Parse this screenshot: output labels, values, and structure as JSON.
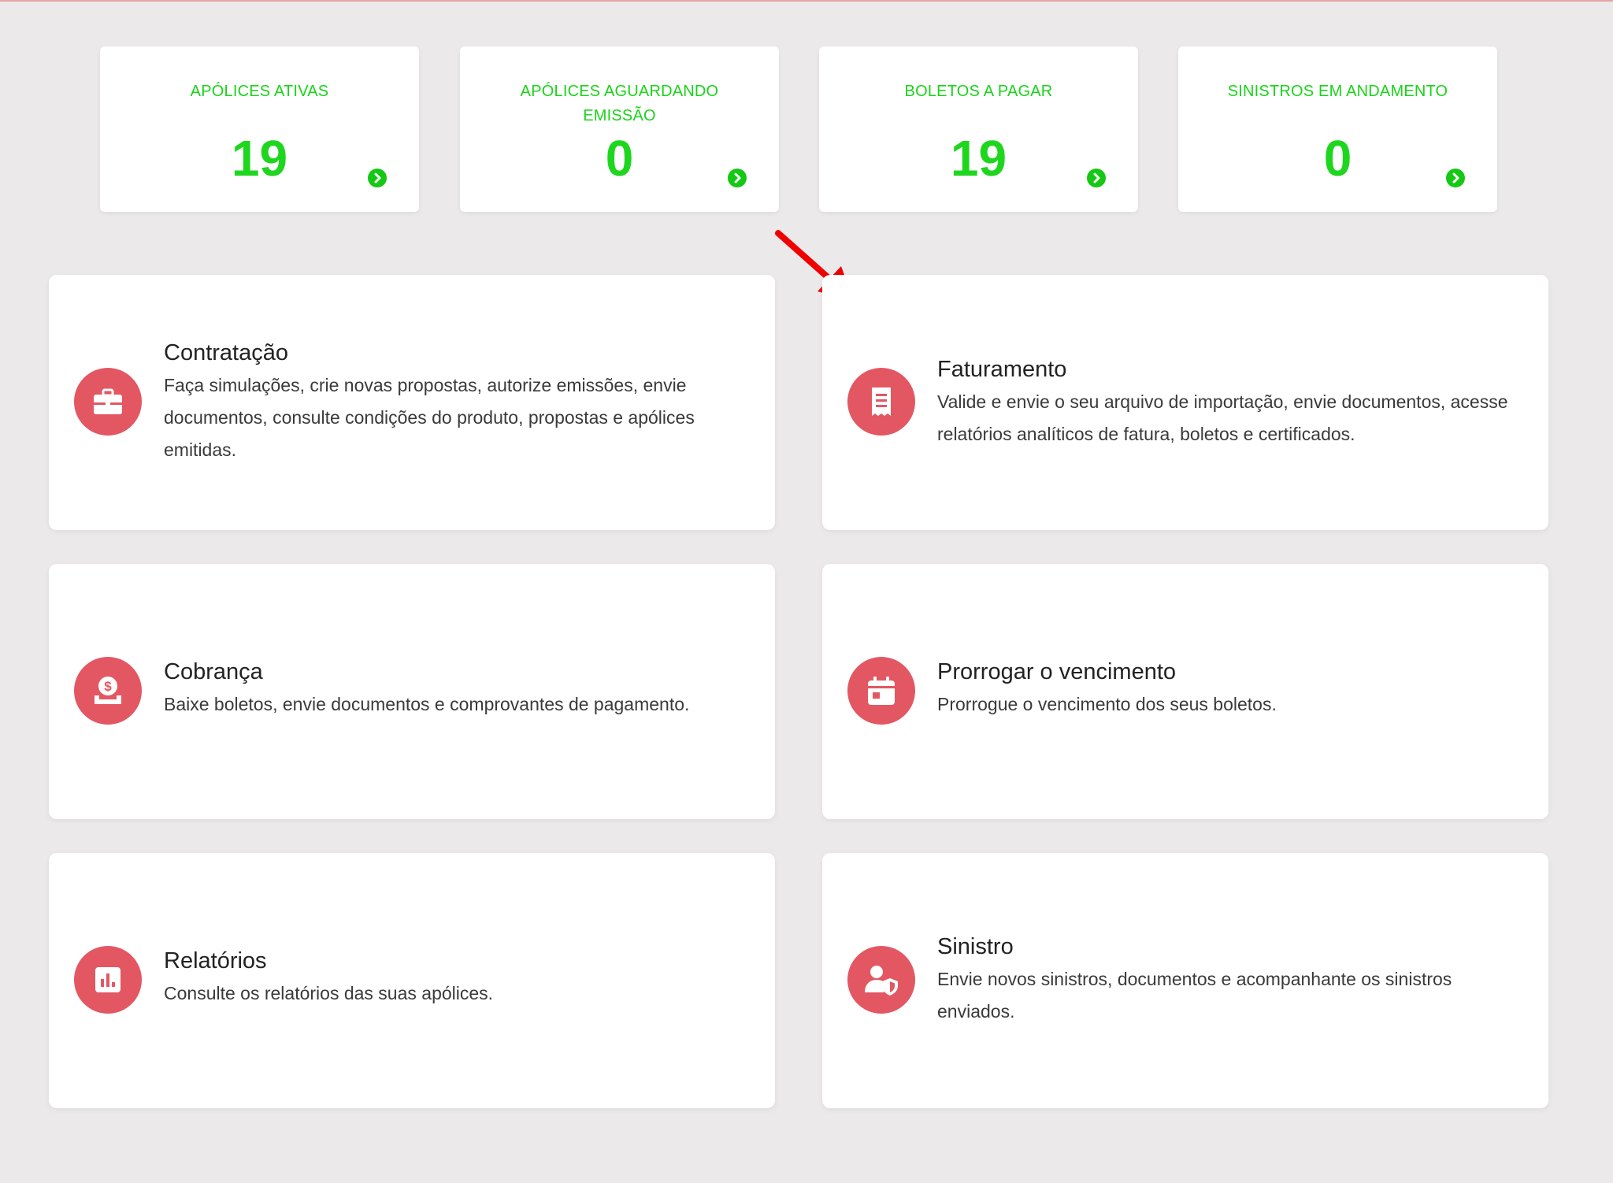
{
  "stats": [
    {
      "label": "APÓLICES ATIVAS",
      "value": "19"
    },
    {
      "label": "APÓLICES AGUARDANDO EMISSÃO",
      "value": "0"
    },
    {
      "label": "BOLETOS A PAGAR",
      "value": "19"
    },
    {
      "label": "SINISTROS EM ANDAMENTO",
      "value": "0"
    }
  ],
  "cards": [
    {
      "title": "Contratação",
      "description": "Faça simulações, crie novas propostas, autorize emissões, envie documentos, consulte condições do produto, propostas e apólices emitidas.",
      "icon": "briefcase-icon"
    },
    {
      "title": "Faturamento",
      "description": "Valide e envie o seu arquivo de importação, envie documentos, acesse relatórios analíticos de fatura, boletos e certificados.",
      "icon": "receipt-icon"
    },
    {
      "title": "Cobrança",
      "description": "Baixe boletos, envie documentos e comprovantes de pagamento.",
      "icon": "money-tray-icon"
    },
    {
      "title": "Prorrogar o vencimento",
      "description": "Prorrogue o vencimento dos seus boletos.",
      "icon": "calendar-icon"
    },
    {
      "title": "Relatórios",
      "description": "Consulte os relatórios das suas apólices.",
      "icon": "bar-chart-icon"
    },
    {
      "title": "Sinistro",
      "description": "Envie novos sinistros, documentos e acompanhante os sinistros enviados.",
      "icon": "user-shield-icon"
    }
  ],
  "colors": {
    "accent_green": "#1fd61f",
    "icon_red": "#e35762",
    "annotation_red": "#f00000",
    "background": "#ebe9ea"
  }
}
